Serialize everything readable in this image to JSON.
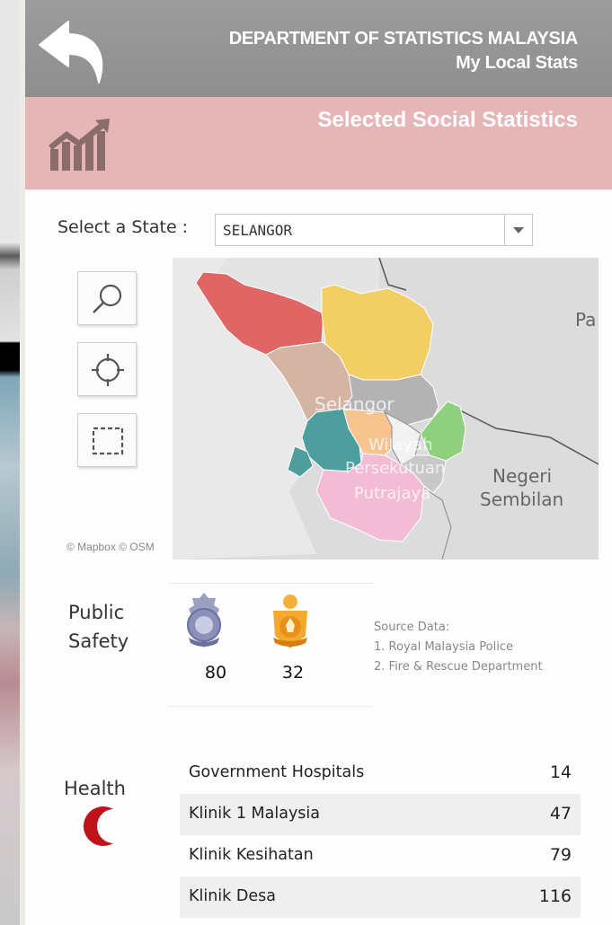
{
  "header": {
    "line1": "DEPARTMENT OF STATISTICS MALAYSIA",
    "line2": "My Local Stats",
    "back_icon": "back-arrow-icon"
  },
  "subheader": {
    "title": "Selected Social Statistics",
    "icon": "chart-trend-icon"
  },
  "state_selector": {
    "label": "Select a State :",
    "value": "SELANGOR"
  },
  "map": {
    "tools": [
      "search-icon",
      "locate-icon",
      "select-area-icon"
    ],
    "labels": {
      "state": "Selangor",
      "territory1": "Wilayah",
      "territory2": "Persekutuan",
      "territory3": "Putrajaya",
      "neighbor1": "Negeri",
      "neighbor2": "Sembilan",
      "neighbor_edge": "Pa"
    },
    "attribution": "© Mapbox  © OSM",
    "region_colors": [
      "#e06666",
      "#f1cf64",
      "#d4b5a3",
      "#b3b3b3",
      "#4e9e9e",
      "#f7c490",
      "#8fd07f",
      "#f2bcd5"
    ]
  },
  "public_safety": {
    "label_line1": "Public",
    "label_line2": "Safety",
    "police_count": "80",
    "fire_count": "32",
    "source_title": "Source Data:",
    "source_1": "1. Royal Malaysia Police",
    "source_2": "2. Fire & Rescue Department"
  },
  "health": {
    "label": "Health",
    "rows": [
      {
        "name": "Government Hospitals",
        "value": "14"
      },
      {
        "name": "Klinik 1 Malaysia",
        "value": "47"
      },
      {
        "name": "Klinik Kesihatan",
        "value": "79"
      },
      {
        "name": "Klinik Desa",
        "value": "116"
      }
    ]
  }
}
